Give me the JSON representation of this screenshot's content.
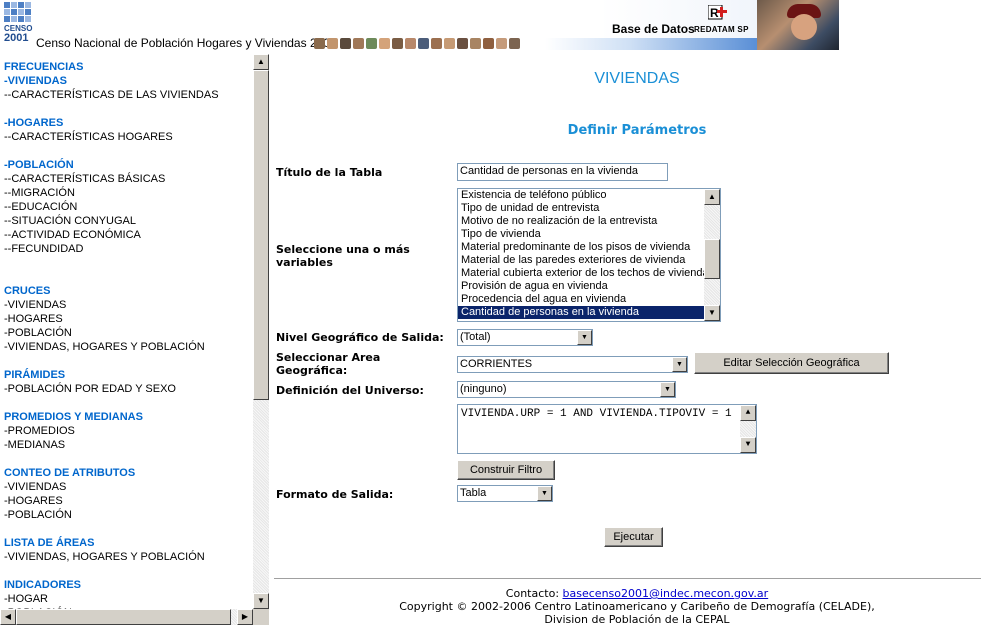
{
  "header": {
    "logo_censo": "CENSO",
    "logo_year": "2001",
    "title": "Censo Nacional de Población Hogares y Viviendas 2001",
    "base_datos": "Base de Datos",
    "redatam": "REDATAM SP"
  },
  "sidebar": {
    "sections": [
      {
        "title": "FRECUENCIAS",
        "items": [
          {
            "label": "-VIVIENDAS",
            "active": true
          },
          {
            "label": "--CARACTERÍSTICAS DE LAS VIVIENDAS"
          }
        ]
      },
      {
        "title": "",
        "items": [
          {
            "label": "-HOGARES",
            "active": true
          },
          {
            "label": "--CARACTERÍSTICAS HOGARES"
          }
        ]
      },
      {
        "title": "",
        "items": [
          {
            "label": "-POBLACIÓN",
            "active": true
          },
          {
            "label": "--CARACTERÍSTICAS BÁSICAS"
          },
          {
            "label": "--MIGRACIÓN"
          },
          {
            "label": "--EDUCACIÓN"
          },
          {
            "label": "--SITUACIÓN CONYUGAL"
          },
          {
            "label": "--ACTIVIDAD ECONÓMICA"
          },
          {
            "label": "--FECUNDIDAD"
          }
        ]
      },
      {
        "title": "CRUCES",
        "items": [
          {
            "label": "-VIVIENDAS"
          },
          {
            "label": "-HOGARES"
          },
          {
            "label": "-POBLACIÓN"
          },
          {
            "label": "-VIVIENDAS, HOGARES Y POBLACIÓN"
          }
        ]
      },
      {
        "title": "PIRÁMIDES",
        "items": [
          {
            "label": "-POBLACIÓN POR EDAD Y SEXO"
          }
        ]
      },
      {
        "title": "PROMEDIOS Y MEDIANAS",
        "items": [
          {
            "label": "-PROMEDIOS"
          },
          {
            "label": "-MEDIANAS"
          }
        ]
      },
      {
        "title": "CONTEO DE ATRIBUTOS",
        "items": [
          {
            "label": "-VIVIENDAS"
          },
          {
            "label": "-HOGARES"
          },
          {
            "label": "-POBLACIÓN"
          }
        ]
      },
      {
        "title": "LISTA DE ÁREAS",
        "items": [
          {
            "label": "-VIVIENDAS, HOGARES Y POBLACIÓN"
          }
        ]
      },
      {
        "title": "INDICADORES",
        "items": [
          {
            "label": "-HOGAR"
          },
          {
            "label": "-POBLACIÓN"
          }
        ]
      }
    ]
  },
  "main": {
    "heading": "VIVIENDAS",
    "subheading": "Definir Parámetros",
    "titulo_label": "Título de la Tabla",
    "titulo_value": "Cantidad de personas en la vivienda",
    "variables_label": "Seleccione una o más variables",
    "variables": [
      "Existencia de teléfono público",
      "Tipo de unidad de entrevista",
      "Motivo de no realización de la entrevista",
      "Tipo de vivienda",
      "Material predominante de los pisos de vivienda",
      "Material de las paredes exteriores de vivienda",
      "Material cubierta exterior de los techos de vivienda",
      "Provisión de agua en vivienda",
      "Procedencia del agua en vivienda",
      "Cantidad de personas en la vivienda"
    ],
    "selected_variable": "Cantidad de personas en la vivienda",
    "nivel_label": "Nivel Geográfico de Salida:",
    "nivel_value": "(Total)",
    "area_label": "Seleccionar Area Geográfica:",
    "area_value": "CORRIENTES",
    "editar_button": "Editar Selección Geográfica",
    "universo_label": "Definición del Universo:",
    "universo_value": "(ninguno)",
    "universo_expr": "VIVIENDA.URP = 1 AND VIVIENDA.TIPOVIV = 1",
    "construir_button": "Construir Filtro",
    "formato_label": "Formato de Salida:",
    "formato_value": "Tabla",
    "ejecutar_button": "Ejecutar"
  },
  "footer": {
    "contacto_label": "Contacto:",
    "email": "basecenso2001@indec.mecon.gov.ar",
    "copyright": "Copyright © 2002-2006 Centro Latinoamericano y Caribeño de Demografía (CELADE),",
    "division": "Division de Población de la CEPAL"
  },
  "colors": {
    "accent": "#1a8fd6",
    "link": "#0066cc",
    "selection": "#0a246a"
  }
}
